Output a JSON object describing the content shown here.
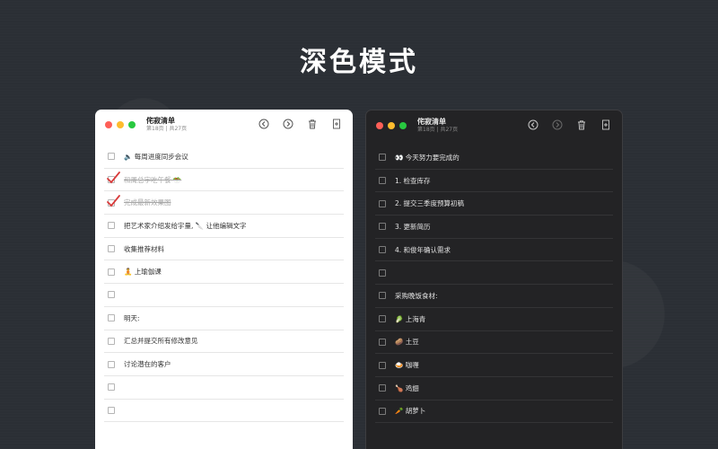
{
  "headline": "深色模式",
  "light": {
    "title": "侘寂清单",
    "subtitle": "第18页 | 共27页",
    "items": [
      {
        "text": "🔈 每周进度同步会议",
        "done": false
      },
      {
        "text": "和周总宇吃午餐 🥗",
        "done": true
      },
      {
        "text": "完成最新效果图",
        "done": true
      },
      {
        "text": "把艺术家介绍发给宇量, 🔪 让他编辑文字",
        "done": false
      },
      {
        "text": "收集推荐材料",
        "done": false
      },
      {
        "text": "🧘 上瑜伽课",
        "done": false
      },
      {
        "text": "",
        "done": false
      },
      {
        "text": "明天:",
        "done": false
      },
      {
        "text": "汇总并提交所有修改意见",
        "done": false
      },
      {
        "text": "讨论潜在的客户",
        "done": false
      },
      {
        "text": "",
        "done": false
      },
      {
        "text": "",
        "done": false
      }
    ]
  },
  "dark": {
    "title": "侘寂清单",
    "subtitle": "第18页 | 共27页",
    "items": [
      {
        "text": "👀 今天努力要完成的",
        "done": false
      },
      {
        "text": "1. 检查库存",
        "done": false
      },
      {
        "text": "2. 提交三季度预算初稿",
        "done": false
      },
      {
        "text": "3. 更新简历",
        "done": false
      },
      {
        "text": "4. 和俊年确认需求",
        "done": false
      },
      {
        "text": "",
        "done": false
      },
      {
        "text": "采购晚饭食材:",
        "done": false
      },
      {
        "text": "🥬 上海青",
        "done": false
      },
      {
        "text": "🥔 土豆",
        "done": false
      },
      {
        "text": "🍛 咖喱",
        "done": false
      },
      {
        "text": "🍗 鸡翅",
        "done": false
      },
      {
        "text": "🥕 胡萝卜",
        "done": false
      }
    ]
  },
  "toolbar_icons": [
    "back-arrow-icon",
    "forward-arrow-icon",
    "trash-icon",
    "new-page-icon"
  ],
  "colors": {
    "background": "#2b2f35",
    "light_window": "#ffffff",
    "dark_window": "#232325",
    "check_red": "#d93a3a",
    "traffic_red": "#fe5f57",
    "traffic_yellow": "#febc2e",
    "traffic_green": "#28c840"
  }
}
